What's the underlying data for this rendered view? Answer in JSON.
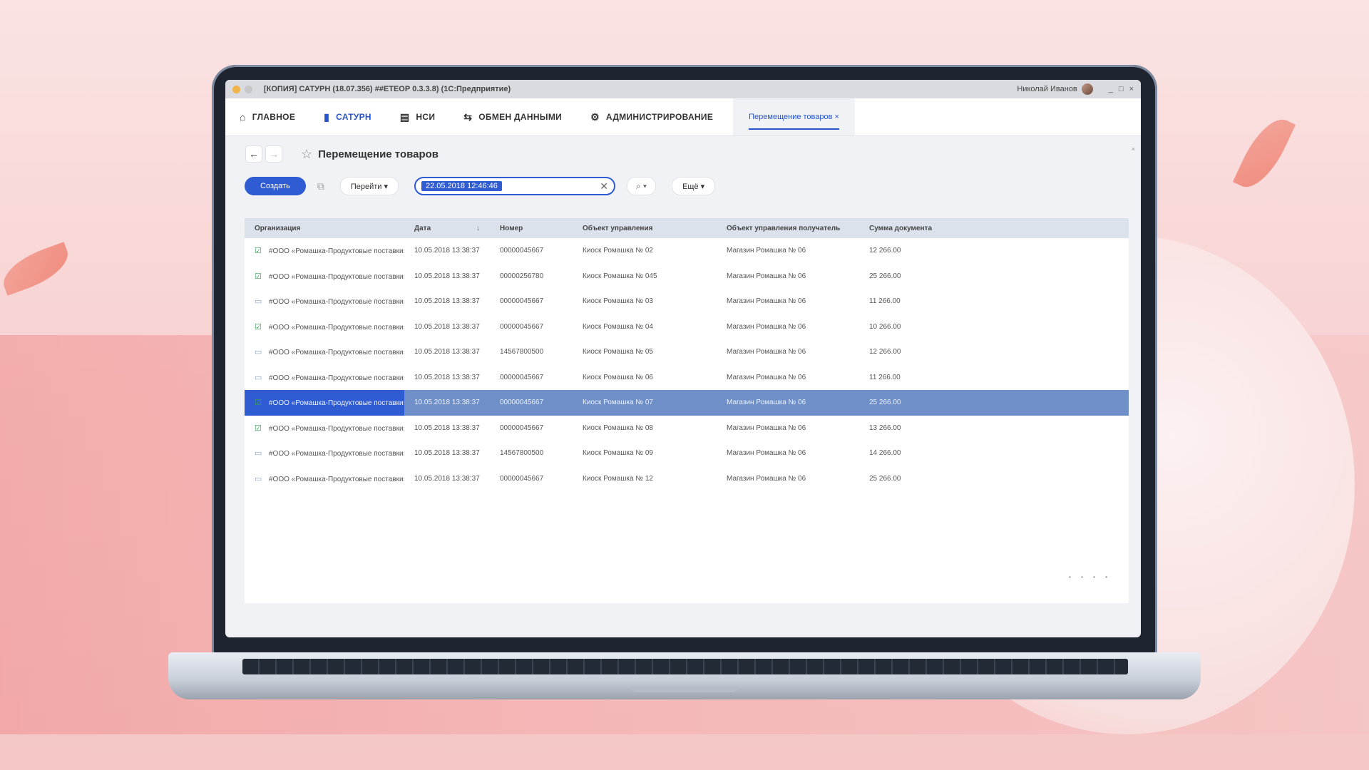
{
  "window": {
    "title": "[КОПИЯ] САТУРН (18.07.356) ##ЕТЕОР 0.3.3.8) (1С:Предприятие)",
    "user": "Николай Иванов",
    "controls": [
      "_",
      "□",
      "×"
    ]
  },
  "nav": {
    "items": [
      {
        "label": "ГЛАВНОЕ",
        "icon": "home-icon",
        "glyph": "⌂"
      },
      {
        "label": "САТУРН",
        "icon": "bookmark-icon",
        "glyph": "▮"
      },
      {
        "label": "НСИ",
        "icon": "document-icon",
        "glyph": "▤"
      },
      {
        "label": "ОБМЕН ДАННЫМИ",
        "icon": "exchange-icon",
        "glyph": "⇆"
      },
      {
        "label": "АДМИНИСТРИРОВАНИЕ",
        "icon": "gear-icon",
        "glyph": "⚙"
      }
    ],
    "open_tab": "Перемещение товаров ×"
  },
  "page": {
    "title": "Перемещение товаров",
    "back": "←",
    "forward": "→",
    "star": "☆"
  },
  "toolbar": {
    "create_label": "Создать",
    "copy_icon": "⧉",
    "goto_label": "Перейти ▾",
    "search_value": "22.05.2018 12:46:46",
    "clear": "✕",
    "search_btn": "⌕ ▾",
    "more_label": "Ещё ▾"
  },
  "table": {
    "columns": [
      "Организация",
      "Дата",
      "Номер",
      "Объект управления",
      "Объект управления получатель",
      "Сумма документа"
    ],
    "sort_icon": "↓",
    "rows": [
      {
        "status": "ok",
        "org": "#ООО «Ромашка-Продуктовые поставки»",
        "date": "10.05.2018  13:38:37",
        "num": "00000045667",
        "obj": "Киоск Ромашка № 02",
        "recv": "Магазин Ромашка № 06",
        "sum": "12 266.00"
      },
      {
        "status": "ok",
        "org": "#ООО «Ромашка-Продуктовые поставки»",
        "date": "10.05.2018  13:38:37",
        "num": "00000256780",
        "obj": "Киоск Ромашка № 045",
        "recv": "Магазин Ромашка № 06",
        "sum": "25 266.00"
      },
      {
        "status": "doc",
        "org": "#ООО «Ромашка-Продуктовые поставки»",
        "date": "10.05.2018  13:38:37",
        "num": "00000045667",
        "obj": "Киоск Ромашка № 03",
        "recv": "Магазин Ромашка № 06",
        "sum": "11 266.00"
      },
      {
        "status": "ok",
        "org": "#ООО «Ромашка-Продуктовые поставки»",
        "date": "10.05.2018  13:38:37",
        "num": "00000045667",
        "obj": "Киоск Ромашка № 04",
        "recv": "Магазин Ромашка № 06",
        "sum": "10 266.00"
      },
      {
        "status": "doc",
        "org": "#ООО «Ромашка-Продуктовые поставки»",
        "date": "10.05.2018  13:38:37",
        "num": "14567800500",
        "obj": "Киоск Ромашка № 05",
        "recv": "Магазин Ромашка № 06",
        "sum": "12 266.00"
      },
      {
        "status": "doc",
        "org": "#ООО «Ромашка-Продуктовые поставки»",
        "date": "10.05.2018  13:38:37",
        "num": "00000045667",
        "obj": "Киоск Ромашка № 06",
        "recv": "Магазин Ромашка № 06",
        "sum": "11 266.00"
      },
      {
        "status": "ok",
        "selected": true,
        "org": "#ООО «Ромашка-Продуктовые поставки»",
        "date": "10.05.2018  13:38:37",
        "num": "00000045667",
        "obj": "Киоск Ромашка № 07",
        "recv": "Магазин Ромашка № 06",
        "sum": "25 266.00"
      },
      {
        "status": "ok",
        "org": "#ООО «Ромашка-Продуктовые поставки»",
        "date": "10.05.2018  13:38:37",
        "num": "00000045667",
        "obj": "Киоск Ромашка № 08",
        "recv": "Магазин Ромашка № 06",
        "sum": "13 266.00"
      },
      {
        "status": "doc",
        "org": "#ООО «Ромашка-Продуктовые поставки»",
        "date": "10.05.2018  13:38:37",
        "num": "14567800500",
        "obj": "Киоск Ромашка № 09",
        "recv": "Магазин Ромашка № 06",
        "sum": "14 266.00"
      },
      {
        "status": "doc",
        "org": "#ООО «Ромашка-Продуктовые поставки»",
        "date": "10.05.2018  13:38:37",
        "num": "00000045667",
        "obj": "Киоск Ромашка № 12",
        "recv": "Магазин Ромашка № 06",
        "sum": "25 266.00"
      }
    ],
    "status_glyphs": {
      "ok": "☑",
      "doc": "▭"
    },
    "pager": "• • • •"
  },
  "colors": {
    "accent": "#2f5bd3",
    "selected_row": "#6e8fc8",
    "header_bg": "#dbe2ec",
    "ok": "#3aa35a"
  }
}
